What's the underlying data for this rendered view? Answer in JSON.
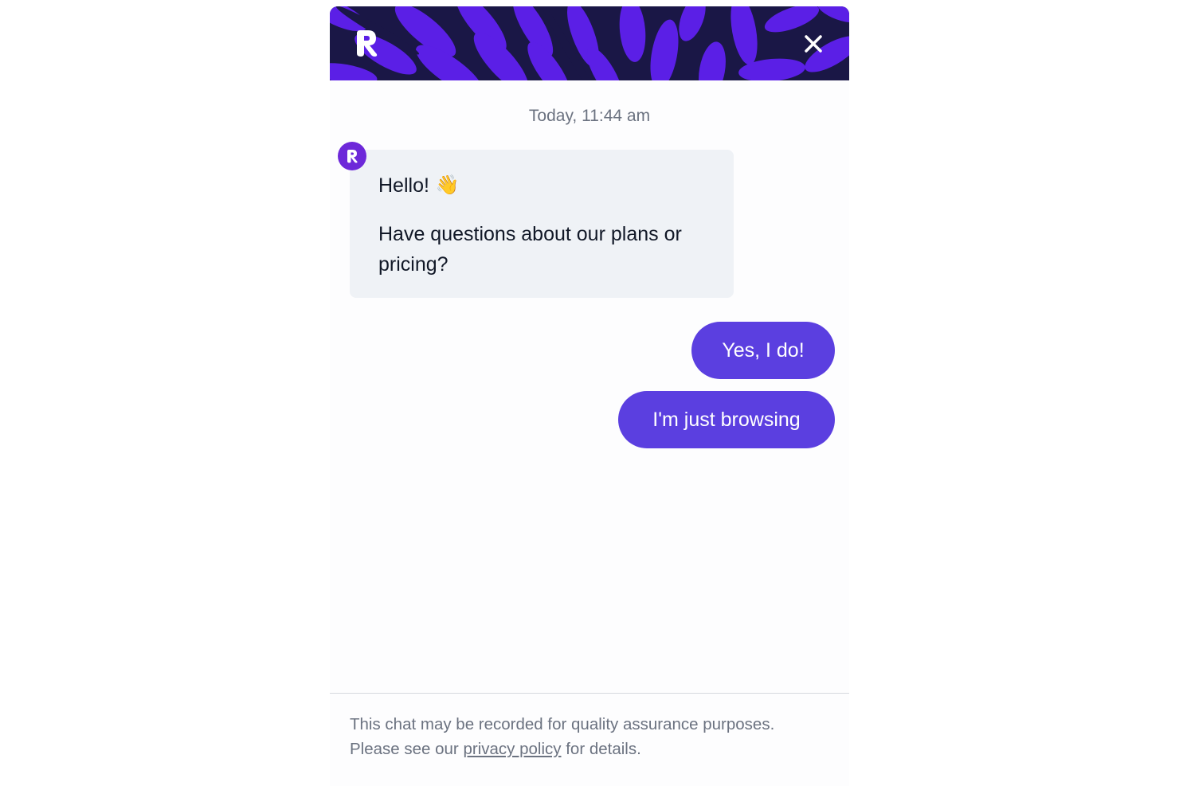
{
  "header": {
    "logo_icon": "r-logo-icon",
    "close_icon": "close-icon",
    "accent_color": "#5b1fe6",
    "background_color": "#1a1746"
  },
  "chat": {
    "timestamp": "Today, 11:44 am",
    "bot_message": {
      "greeting": "Hello!",
      "emoji": "👋",
      "body": "Have questions about our plans or pricing?"
    },
    "quick_replies": [
      {
        "label": "Yes, I do!"
      },
      {
        "label": "I'm just browsing"
      }
    ],
    "reply_color": "#5b3fe0"
  },
  "footer": {
    "line1": "This chat may be recorded for quality assurance purposes.",
    "line2_prefix": "Please see our",
    "link_text": "privacy policy",
    "line2_suffix": "for details."
  }
}
